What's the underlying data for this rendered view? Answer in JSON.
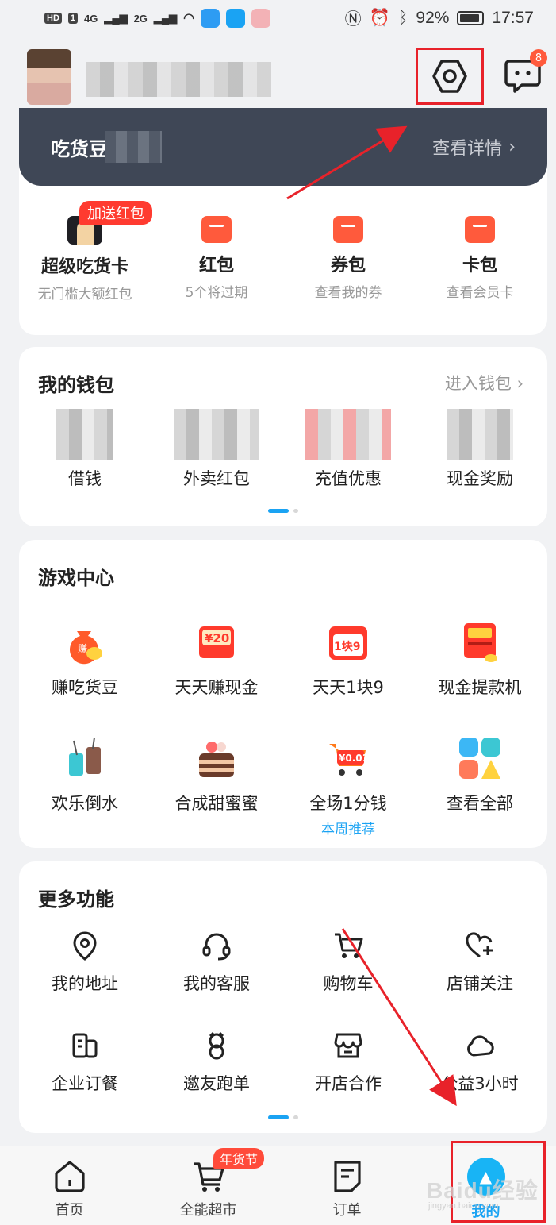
{
  "status_bar": {
    "left_badges": [
      "HD",
      "1",
      "4G",
      "2G"
    ],
    "battery": "92%",
    "time": "17:57",
    "icons": [
      "nfc-icon",
      "alarm-icon",
      "bluetooth-icon"
    ]
  },
  "header": {
    "settings_icon": "settings-hexagon-icon",
    "message_badge": "8"
  },
  "foodbean": {
    "title": "吃货豆",
    "link": "查看详情"
  },
  "benefits": {
    "promo_tag": "加送红包",
    "items": [
      {
        "title": "超级吃货卡",
        "sub": "无门槛大额红包"
      },
      {
        "title": "红包",
        "sub": "5个将过期"
      },
      {
        "title": "券包",
        "sub": "查看我的券"
      },
      {
        "title": "卡包",
        "sub": "查看会员卡"
      }
    ]
  },
  "wallet": {
    "title": "我的钱包",
    "link": "进入钱包",
    "items": [
      {
        "label": "借钱"
      },
      {
        "label": "外卖红包"
      },
      {
        "label": "充值优惠"
      },
      {
        "label": "现金奖励"
      }
    ]
  },
  "games": {
    "title": "游戏中心",
    "row1": [
      {
        "label": "赚吃货豆",
        "icon": "money-bag-icon"
      },
      {
        "label": "天天赚现金",
        "icon": "red-envelope-20-icon"
      },
      {
        "label": "天天1块9",
        "icon": "calendar-1yuan9-icon"
      },
      {
        "label": "现金提款机",
        "icon": "atm-machine-icon"
      }
    ],
    "row2": [
      {
        "label": "欢乐倒水",
        "icon": "drink-cups-icon"
      },
      {
        "label": "合成甜蜜蜜",
        "icon": "cake-icon"
      },
      {
        "label": "全场1分钱",
        "icon": "shopping-cart-001-icon",
        "sub": "本周推荐"
      },
      {
        "label": "查看全部",
        "icon": "app-grid-icon"
      }
    ]
  },
  "more": {
    "title": "更多功能",
    "row1": [
      {
        "label": "我的地址",
        "icon": "location-pin-icon"
      },
      {
        "label": "我的客服",
        "icon": "headset-icon"
      },
      {
        "label": "购物车",
        "icon": "cart-icon"
      },
      {
        "label": "店铺关注",
        "icon": "heart-plus-icon"
      }
    ],
    "row2": [
      {
        "label": "企业订餐",
        "icon": "building-icon"
      },
      {
        "label": "邀友跑单",
        "icon": "rider-icon"
      },
      {
        "label": "开店合作",
        "icon": "storefront-icon"
      },
      {
        "label": "公益3小时",
        "icon": "cloud-icon"
      }
    ]
  },
  "nav": {
    "items": [
      {
        "label": "首页"
      },
      {
        "label": "全能超市",
        "tag": "年货节"
      },
      {
        "label": "订单"
      },
      {
        "label": "我的"
      }
    ]
  },
  "watermark": {
    "main": "Baidu经验",
    "sub": "jingyan.baidu.com"
  },
  "colors": {
    "accent": "#1aa3f3",
    "red": "#ff5a3c",
    "dark_bar": "#3f4756",
    "annotation": "#e8222a"
  }
}
